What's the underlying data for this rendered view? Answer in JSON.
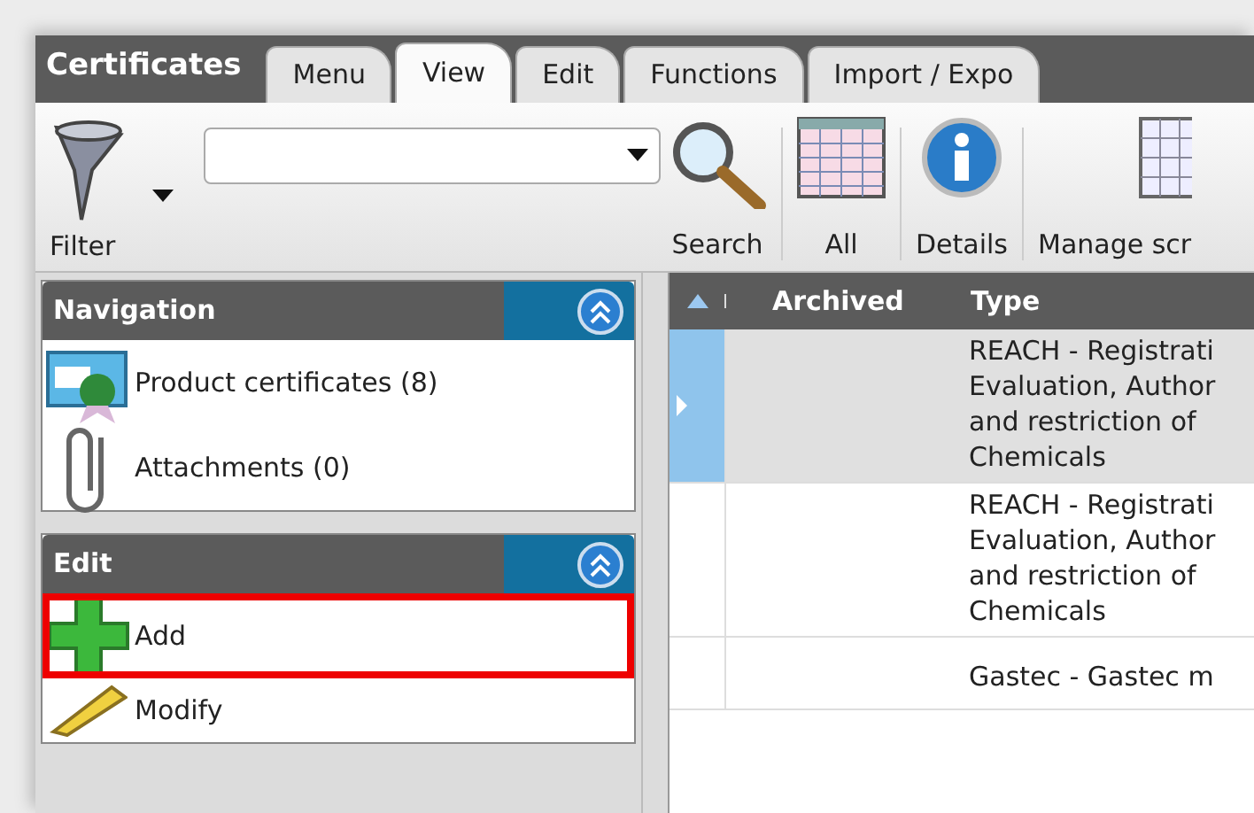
{
  "app": {
    "title": "Certificates"
  },
  "tabs": [
    {
      "label": "Menu",
      "selected": false
    },
    {
      "label": "View",
      "selected": true
    },
    {
      "label": "Edit",
      "selected": false
    },
    {
      "label": "Functions",
      "selected": false
    },
    {
      "label": "Import / Expo",
      "selected": false
    }
  ],
  "toolbar": {
    "filter_label": "Filter",
    "buttons": [
      {
        "kind": "search",
        "label": "Search"
      },
      {
        "kind": "all",
        "label": "All"
      },
      {
        "kind": "details",
        "label": "Details"
      },
      {
        "kind": "manage",
        "label": "Manage scr"
      }
    ]
  },
  "panels": [
    {
      "title": "Navigation",
      "expanded": true,
      "items": [
        {
          "kind": "certificate",
          "label": "Product certificates (8)",
          "highlighted": false
        },
        {
          "kind": "attachment",
          "label": "Attachments (0)",
          "highlighted": false
        }
      ]
    },
    {
      "title": "Edit",
      "expanded": true,
      "items": [
        {
          "kind": "add",
          "label": "Add",
          "highlighted": true
        },
        {
          "kind": "modify",
          "label": "Modify",
          "highlighted": false
        }
      ]
    }
  ],
  "table": {
    "columns": [
      "Archived",
      "Type"
    ],
    "rows": [
      {
        "selected": true,
        "type": "REACH - Registrati\nEvaluation, Author\nand restriction of\nChemicals"
      },
      {
        "selected": false,
        "type": "REACH - Registrati\nEvaluation, Author\nand restriction of\nChemicals"
      },
      {
        "selected": false,
        "type": "Gastec - Gastec m"
      }
    ]
  }
}
